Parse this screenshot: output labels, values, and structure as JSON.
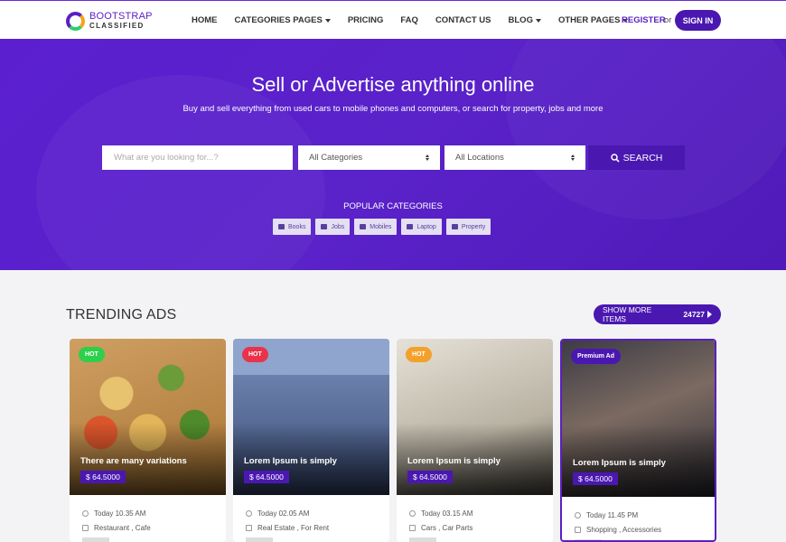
{
  "navbar": {
    "logo_top": "BOOTSTRAP",
    "logo_bottom": "CLASSIFIED",
    "items": [
      {
        "label": "HOME",
        "dropdown": false
      },
      {
        "label": "CATEGORIES PAGES",
        "dropdown": true
      },
      {
        "label": "PRICING",
        "dropdown": false
      },
      {
        "label": "FAQ",
        "dropdown": false
      },
      {
        "label": "CONTACT US",
        "dropdown": false
      },
      {
        "label": "BLOG",
        "dropdown": true
      },
      {
        "label": "OTHER PAGES",
        "dropdown": true
      }
    ],
    "register": "REGISTER",
    "or": "or",
    "signin": "SIGN IN"
  },
  "hero": {
    "title": "Sell or Advertise anything online",
    "subtitle": "Buy and sell everything from used cars to mobile phones and computers, or search for property, jobs and more",
    "search_placeholder": "What are you looking for...?",
    "category_select": "All Categories",
    "location_select": "All Locations",
    "search_button": "SEARCH",
    "popular_title": "POPULAR CATEGORIES",
    "popular": [
      "Books",
      "Jobs",
      "Mobiles",
      "Laptop",
      "Property"
    ]
  },
  "trending": {
    "title": "TRENDING ADS",
    "show_more": "SHOW MORE ITEMS",
    "count": "24727",
    "cards": [
      {
        "badge": "HOT",
        "title": "There are many variations",
        "price": "$ 64.5000",
        "time": "Today 10.35 AM",
        "category": "Restaurant , Cafe"
      },
      {
        "badge": "HOT",
        "title": "Lorem Ipsum is simply",
        "price": "$ 64.5000",
        "time": "Today 02.05 AM",
        "category": "Real Estate , For Rent"
      },
      {
        "badge": "HOT",
        "title": "Lorem Ipsum is simply",
        "price": "$ 64.5000",
        "time": "Today 03.15 AM",
        "category": "Cars , Car Parts"
      },
      {
        "badge": "Premium Ad",
        "title": "Lorem Ipsum is simply",
        "price": "$ 64.5000",
        "time": "Today 11.45 PM",
        "category": "Shopping , Accessories"
      }
    ]
  },
  "colors": {
    "primary": "#4a18b0",
    "hero": "#5b1fd0",
    "badge_green": "#2ecf4a",
    "badge_red": "#e8334a",
    "badge_orange": "#f2a12c",
    "badge_purple": "#4a18b0"
  },
  "icons": {
    "search": "search-icon",
    "clock": "clock-icon",
    "tag": "tag-icon"
  }
}
